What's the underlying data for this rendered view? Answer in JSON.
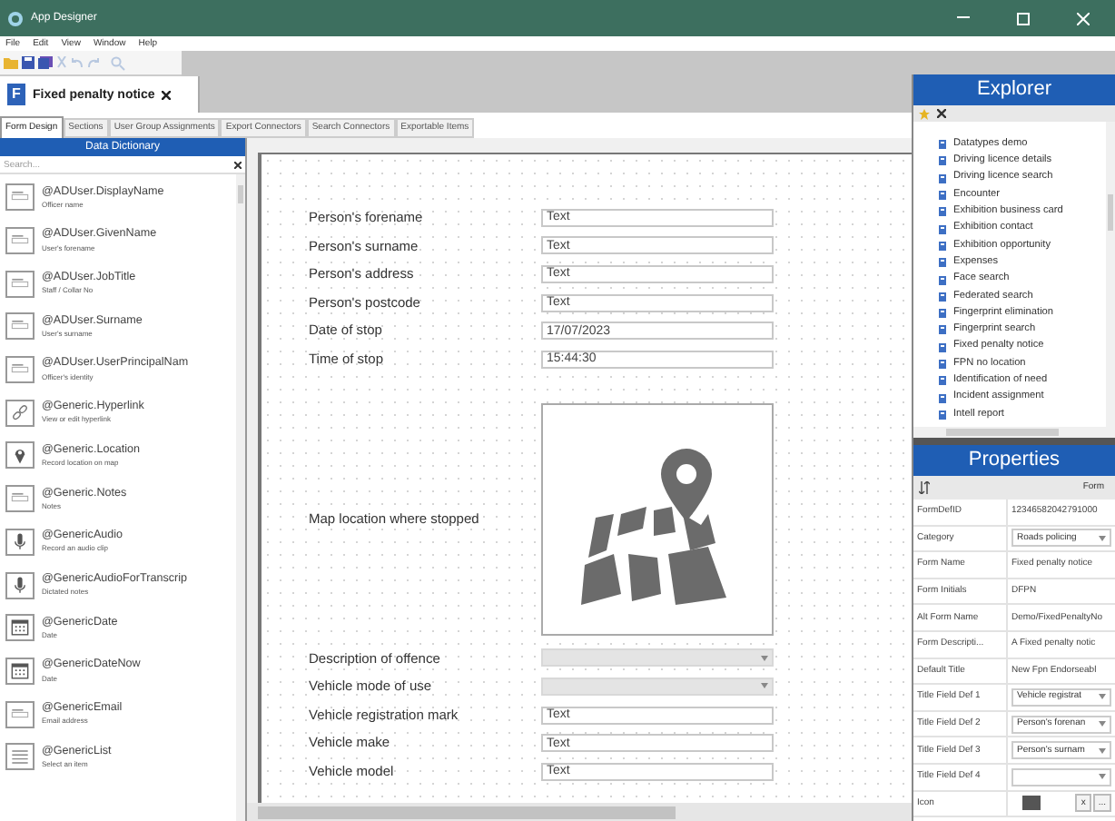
{
  "window": {
    "title": "App Designer"
  },
  "menu": [
    "File",
    "Edit",
    "View",
    "Window",
    "Help"
  ],
  "document_tab": {
    "badge": "F",
    "title": "Fixed penalty notice"
  },
  "tabs": [
    {
      "label": "Form Design",
      "selected": true
    },
    {
      "label": "Sections",
      "selected": false
    },
    {
      "label": "User Group Assignments",
      "selected": false
    },
    {
      "label": "Export Connectors",
      "selected": false
    },
    {
      "label": "Search Connectors",
      "selected": false
    },
    {
      "label": "Exportable Items",
      "selected": false
    }
  ],
  "data_dictionary": {
    "title": "Data Dictionary",
    "search_placeholder": "Search...",
    "items": [
      {
        "kind": "text",
        "name": "@ADUser.DisplayName",
        "description": "Officer name"
      },
      {
        "kind": "text",
        "name": "@ADUser.GivenName",
        "description": "User's forename"
      },
      {
        "kind": "text",
        "name": "@ADUser.JobTitle",
        "description": "Staff / Collar No"
      },
      {
        "kind": "text",
        "name": "@ADUser.Surname",
        "description": "User's surname"
      },
      {
        "kind": "text",
        "name": "@ADUser.UserPrincipalNam",
        "description": "Officer's identity"
      },
      {
        "kind": "link",
        "name": "@Generic.Hyperlink",
        "description": "View or edit hyperlink"
      },
      {
        "kind": "location",
        "name": "@Generic.Location",
        "description": "Record location on map"
      },
      {
        "kind": "text",
        "name": "@Generic.Notes",
        "description": "Notes"
      },
      {
        "kind": "audio",
        "name": "@GenericAudio",
        "description": "Record an audio clip"
      },
      {
        "kind": "audio",
        "name": "@GenericAudioForTranscrip",
        "description": "Dictated notes"
      },
      {
        "kind": "date",
        "name": "@GenericDate",
        "description": "Date"
      },
      {
        "kind": "date",
        "name": "@GenericDateNow",
        "description": "Date"
      },
      {
        "kind": "text",
        "name": "@GenericEmail",
        "description": "Email address"
      },
      {
        "kind": "list",
        "name": "@GenericList",
        "description": "Select an item"
      }
    ]
  },
  "form": {
    "rows": [
      {
        "kind": "text",
        "label": "Person's forename",
        "value": "Text"
      },
      {
        "kind": "text",
        "label": "Person's surname",
        "value": "Text"
      },
      {
        "kind": "text",
        "label": "Person's address",
        "value": "Text"
      },
      {
        "kind": "text",
        "label": "Person's postcode",
        "value": "Text"
      },
      {
        "kind": "text",
        "label": "Date of stop",
        "value": "17/07/2023"
      },
      {
        "kind": "text",
        "label": "Time of stop",
        "value": "15:44:30"
      },
      {
        "kind": "map",
        "label": "Map location where stopped"
      },
      {
        "kind": "dropdown",
        "label": "Description of offence",
        "disabled": true
      },
      {
        "kind": "dropdown",
        "label": "Vehicle mode of use",
        "disabled": true
      },
      {
        "kind": "text",
        "label": "Vehicle registration mark",
        "value": "Text"
      },
      {
        "kind": "text",
        "label": "Vehicle make",
        "value": "Text"
      },
      {
        "kind": "text",
        "label": "Vehicle model",
        "value": "Text"
      }
    ]
  },
  "explorer": {
    "title": "Explorer",
    "items": [
      "Datatypes demo",
      "Driving licence details",
      "Driving licence search",
      "Encounter",
      "Exhibition business card",
      "Exhibition contact",
      "Exhibition opportunity",
      "Expenses",
      "Face search",
      "Federated search",
      "Fingerprint elimination",
      "Fingerprint search",
      "Fixed penalty notice",
      "FPN no location",
      "Identification of need",
      "Incident assignment",
      "Intell report"
    ]
  },
  "properties": {
    "title": "Properties",
    "toolbar_label": "Form",
    "rows": [
      {
        "kind": "text",
        "label": "FormDefID",
        "value": "12346582042791000"
      },
      {
        "kind": "dropdown",
        "label": "Category",
        "value": "Roads policing"
      },
      {
        "kind": "text",
        "label": "Form Name",
        "value": "Fixed penalty notice"
      },
      {
        "kind": "text",
        "label": "Form Initials",
        "value": "DFPN"
      },
      {
        "kind": "text",
        "label": "Alt Form Name",
        "value": "Demo/FixedPenaltyNo"
      },
      {
        "kind": "text",
        "label": "Form Descripti...",
        "value": "A Fixed penalty notic"
      },
      {
        "kind": "text",
        "label": "Default Title",
        "value": "New Fpn Endorseabl"
      },
      {
        "kind": "dropdown",
        "label": "Title Field Def 1",
        "value": "Vehicle registrat"
      },
      {
        "kind": "dropdown",
        "label": "Title Field Def 2",
        "value": "Person's forenan"
      },
      {
        "kind": "dropdown",
        "label": "Title Field Def 3",
        "value": "Person's surnam"
      },
      {
        "kind": "dropdown",
        "label": "Title Field Def 4"
      },
      {
        "kind": "icon",
        "label": "Icon",
        "buttons": [
          "x",
          "..."
        ]
      }
    ]
  }
}
